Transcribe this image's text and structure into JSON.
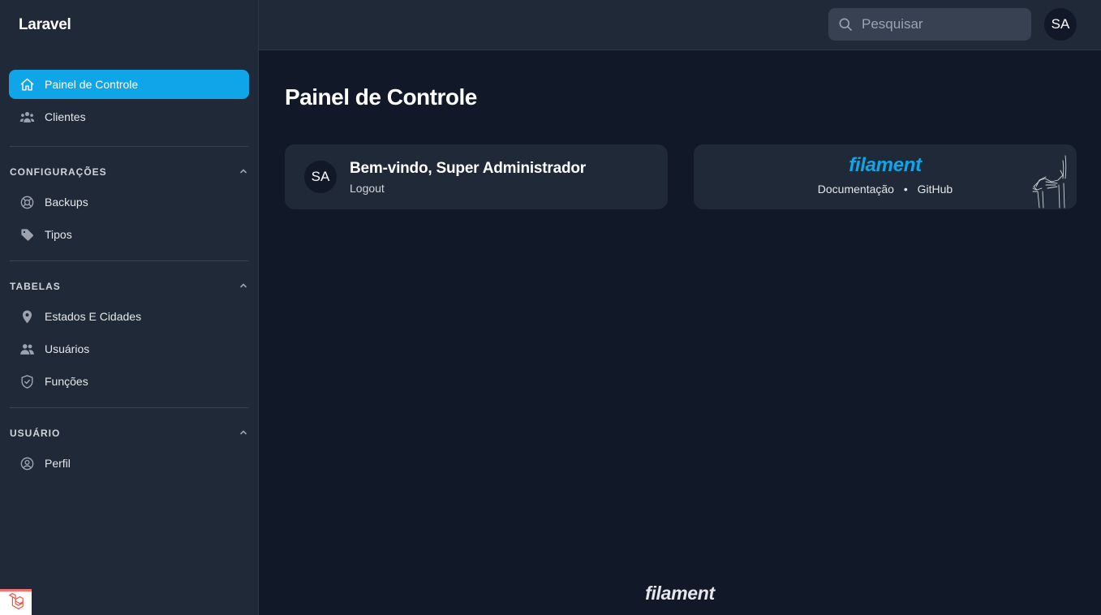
{
  "app": {
    "brand": "Laravel"
  },
  "header": {
    "search_placeholder": "Pesquisar",
    "avatar_initials": "SA"
  },
  "sidebar": {
    "top_items": [
      {
        "label": "Painel de Controle",
        "icon": "home-icon",
        "active": true
      },
      {
        "label": "Clientes",
        "icon": "user-group-icon",
        "active": false
      }
    ],
    "groups": [
      {
        "label": "CONFIGURAÇÕES",
        "collapsed": false,
        "items": [
          {
            "label": "Backups",
            "icon": "lifebuoy-icon"
          },
          {
            "label": "Tipos",
            "icon": "tag-icon"
          }
        ]
      },
      {
        "label": "TABELAS",
        "collapsed": false,
        "items": [
          {
            "label": "Estados E Cidades",
            "icon": "map-pin-icon"
          },
          {
            "label": "Usuários",
            "icon": "users-icon"
          },
          {
            "label": "Funções",
            "icon": "shield-check-icon"
          }
        ]
      },
      {
        "label": "USUÁRIO",
        "collapsed": false,
        "items": [
          {
            "label": "Perfil",
            "icon": "user-circle-icon"
          }
        ]
      }
    ]
  },
  "main": {
    "page_title": "Painel de Controle",
    "welcome": {
      "avatar_initials": "SA",
      "title": "Bem-vindo, Super Administrador",
      "logout_label": "Logout"
    },
    "filament_card": {
      "logo_text": "filament",
      "links": [
        "Documentação",
        "GitHub"
      ],
      "separator": "•"
    },
    "footer_logo": "filament"
  },
  "colors": {
    "background": "#111827",
    "sidebar": "#1f2937",
    "accent": "#0ea5e9",
    "card": "#1f2937"
  }
}
